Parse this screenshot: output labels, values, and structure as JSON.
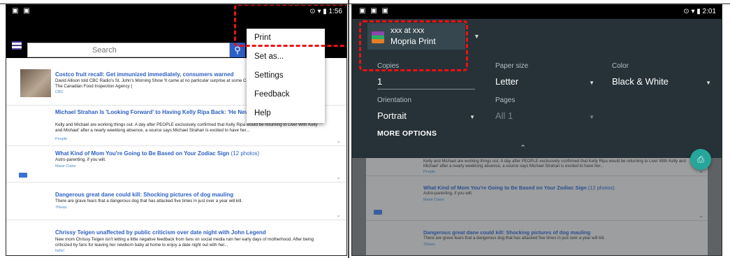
{
  "left": {
    "status": {
      "left_icons": "▣ ▣",
      "right": "⊙ ▾ ▮ 1:56"
    },
    "search": {
      "placeholder": "Search"
    },
    "menu": [
      "Print",
      "Set as...",
      "Settings",
      "Feedback",
      "Help"
    ],
    "articles": [
      {
        "title": "Costco fruit recall: Get immunized immediately, consumers warned",
        "body": "David Allison told CBC Radio's St. John's Morning Show 'It came at no particular surprise at some Costco stores was linked to hepatitis A. The Canadian Food Inspection Agency (",
        "source": "CBC"
      },
      {
        "title": "Michael Strahan Is 'Looking Forward' to Having Kelly Ripa Back: 'He Never W Happen,' Says Source",
        "body": "Kelly and Michael are working things out. A day after PEOPLE exclusively confirmed that Kelly Ripa would be returning to Live! With Kelly and Michael' after a nearly weeklong absence, a source says Michael Strahan is excited to have her...",
        "source": "People"
      },
      {
        "title": "What Kind of Mom You're Going to Be Based on Your Zodiac Sign",
        "count": "(12 photos)",
        "body": "Astro-parenting, if you will.",
        "source": "Marie Claire"
      },
      {
        "title": "Dangerous great dane could kill: Shocking pictures of dog mauling",
        "body": "There are grave fears that a dangerous dog that has attacked five times in just over a year will kill.",
        "source": "7News"
      },
      {
        "title": "Chrissy Teigen unaffected by public criticism over date night with John Legend",
        "body": "New mom Chrissy Teigen isn't letting a little negative feedback from fans on social media ruin her early days of motherhood. After being criticized by fans for leaving her newborn baby at home to enjoy a date night out with her...",
        "source": "hello!"
      }
    ]
  },
  "right": {
    "status": {
      "left_icons": "▣ ▣ ▣",
      "right": "⊙ ▾ ▮ 2:01"
    },
    "printer": {
      "line1": "xxx at xxx",
      "line2": "Mopria Print"
    },
    "options": {
      "copies_label": "Copies",
      "copies": "1",
      "paper_label": "Paper size",
      "paper": "Letter",
      "color_label": "Color",
      "color": "Black & White",
      "orientation_label": "Orientation",
      "orientation": "Portrait",
      "pages_label": "Pages",
      "pages": "All 1",
      "more": "MORE OPTIONS"
    },
    "articles": [
      {
        "body": "Kelly and Michael are working things out. A day after PEOPLE exclusively confirmed that Kelly Ripa would be returning to Live! With Kelly and Michael' after a nearly weeklong absence, a source says Michael Strahan is excited to have her...",
        "source": "People"
      },
      {
        "title": "What Kind of Mom You're Going to Be Based on Your Zodiac Sign",
        "count": "(12 photos)",
        "body": "Astro-parenting, if you will.",
        "source": "Marie Claire"
      },
      {
        "title": "Dangerous great dane could kill: Shocking pictures of dog mauling",
        "body": "There are grave fears that a dangerous dog that has attacked five times in just over a year will kill.",
        "source": "7News"
      }
    ]
  }
}
